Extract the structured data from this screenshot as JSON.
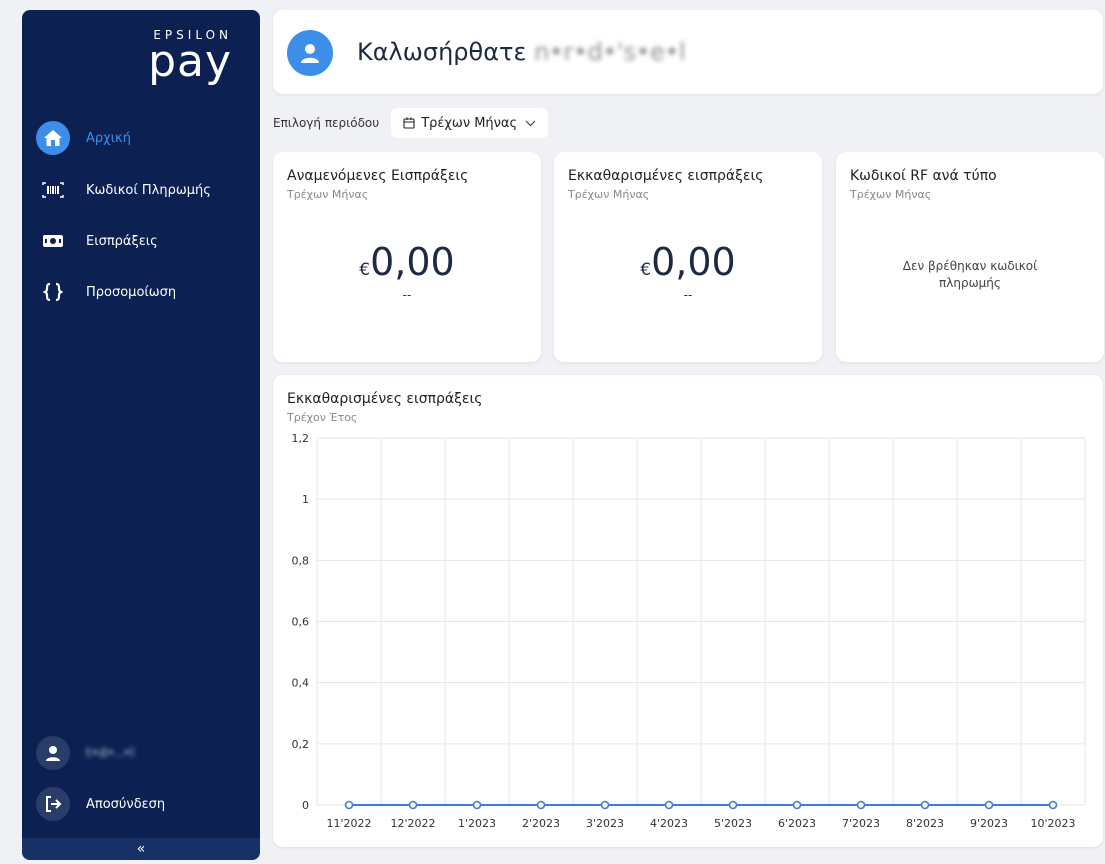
{
  "sidebar": {
    "logo_top": "EPSILON",
    "logo_main": "pay",
    "items": [
      {
        "label": "Αρχική",
        "icon": "home-icon",
        "active": true
      },
      {
        "label": "Κωδικοί Πληρωμής",
        "icon": "barcode-icon",
        "active": false
      },
      {
        "label": "Εισπράξεις",
        "icon": "cash-icon",
        "active": false
      },
      {
        "label": "Προσομοίωση",
        "icon": "braces-icon",
        "active": false
      }
    ],
    "user_name": "t•d•..•l",
    "logout_label": "Αποσύνδεση",
    "collapse_label": "«"
  },
  "header": {
    "welcome": "Καλωσήρθατε",
    "user_name": "n•r•d•'s•e•l"
  },
  "period": {
    "label": "Επιλογή περιόδου",
    "selected": "Τρέχων Μήνας"
  },
  "kpis": [
    {
      "title": "Αναμενόμενες Εισπράξεις",
      "subtitle": "Τρέχων Μήνας",
      "currency": "€",
      "value": "0,00",
      "change": "--"
    },
    {
      "title": "Εκκαθαρισμένες εισπράξεις",
      "subtitle": "Τρέχων Μήνας",
      "currency": "€",
      "value": "0,00",
      "change": "--"
    },
    {
      "title": "Κωδικοί RF ανά τύπο",
      "subtitle": "Τρέχων Μήνας",
      "empty_text": "Δεν βρέθηκαν κωδικοί πληρωμής"
    }
  ],
  "chart": {
    "title": "Εκκαθαρισμένες εισπράξεις",
    "subtitle": "Τρέχον Έτος"
  },
  "chart_data": {
    "type": "line",
    "categories": [
      "11'2022",
      "12'2022",
      "1'2023",
      "2'2023",
      "3'2023",
      "4'2023",
      "5'2023",
      "6'2023",
      "7'2023",
      "8'2023",
      "9'2023",
      "10'2023"
    ],
    "values": [
      0,
      0,
      0,
      0,
      0,
      0,
      0,
      0,
      0,
      0,
      0,
      0
    ],
    "title": "Εκκαθαρισμένες εισπράξεις",
    "xlabel": "",
    "ylabel": "",
    "ylim": [
      0,
      1.2
    ],
    "yticks": [
      "0",
      "0,2",
      "0,4",
      "0,6",
      "0,8",
      "1",
      "1,2"
    ],
    "grid": true,
    "color": "#3d7fd6"
  },
  "colors": {
    "sidebar_bg": "#0c2152",
    "accent": "#3d8ee8"
  }
}
